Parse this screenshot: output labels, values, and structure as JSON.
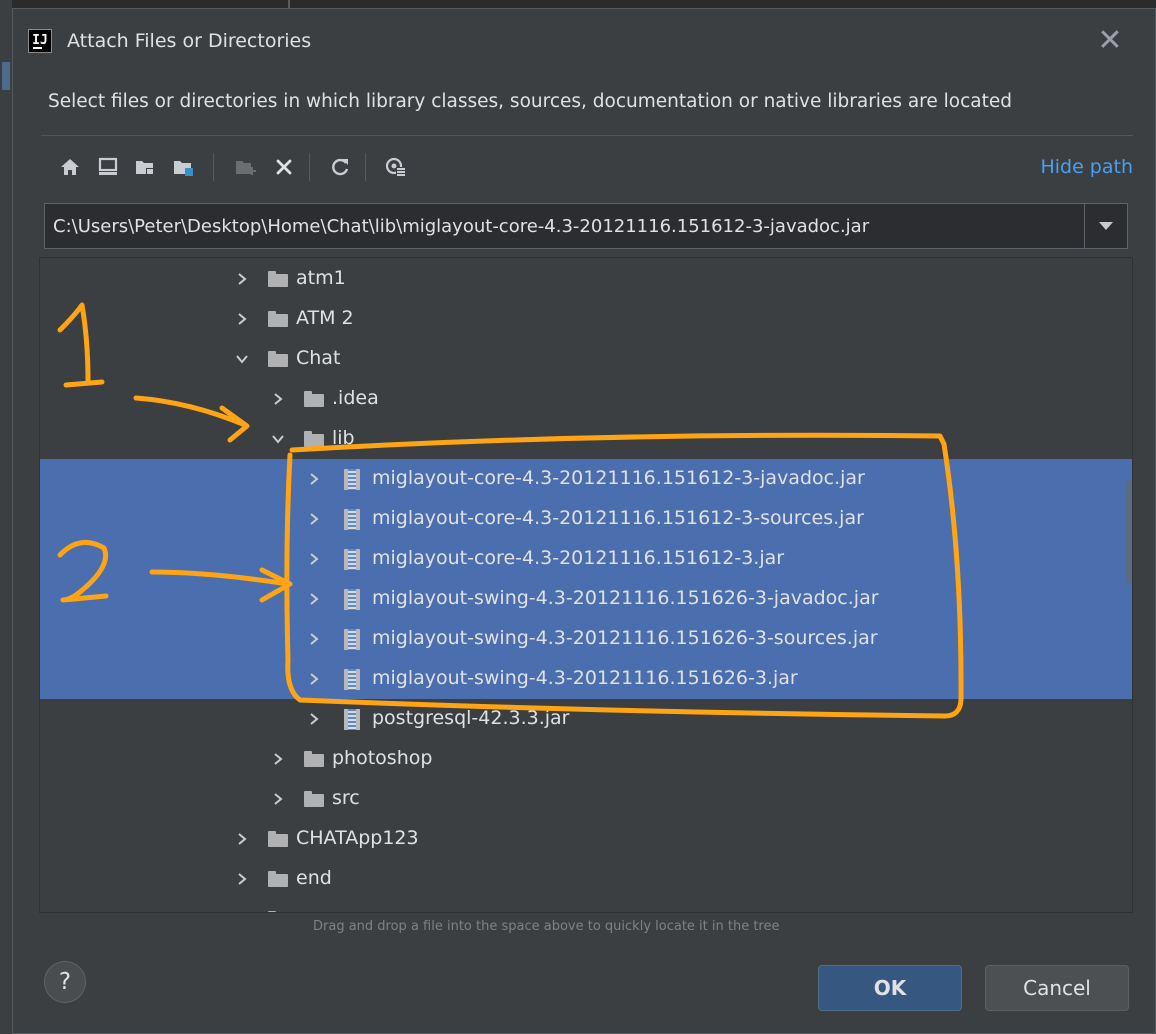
{
  "dialog": {
    "title": "Attach Files or Directories",
    "app_icon_text": "IJ",
    "description": "Select files or directories in which library classes, sources, documentation or native libraries are located"
  },
  "toolbar": {
    "buttons": [
      {
        "name": "home-icon"
      },
      {
        "name": "desktop-icon"
      },
      {
        "name": "project-folder-icon"
      },
      {
        "name": "module-folder-icon"
      },
      {
        "name": "new-folder-icon",
        "disabled": true
      },
      {
        "name": "delete-icon"
      },
      {
        "name": "refresh-icon"
      },
      {
        "name": "show-hidden-icon"
      }
    ],
    "hide_path_label": "Hide path"
  },
  "path": {
    "value": "C:\\Users\\Peter\\Desktop\\Home\\Chat\\lib\\miglayout-core-4.3-20121116.151612-3-javadoc.jar"
  },
  "tree": {
    "rows": [
      {
        "label": "atm1",
        "type": "folder",
        "depth": 0,
        "expanded": false,
        "selected": false
      },
      {
        "label": "ATM 2",
        "type": "folder",
        "depth": 0,
        "expanded": false,
        "selected": false
      },
      {
        "label": "Chat",
        "type": "folder",
        "depth": 0,
        "expanded": true,
        "selected": false
      },
      {
        "label": ".idea",
        "type": "folder",
        "depth": 1,
        "expanded": false,
        "selected": false
      },
      {
        "label": "lib",
        "type": "folder",
        "depth": 1,
        "expanded": true,
        "selected": false
      },
      {
        "label": "miglayout-core-4.3-20121116.151612-3-javadoc.jar",
        "type": "jar",
        "depth": 2,
        "expanded": false,
        "selected": true
      },
      {
        "label": "miglayout-core-4.3-20121116.151612-3-sources.jar",
        "type": "jar",
        "depth": 2,
        "expanded": false,
        "selected": true
      },
      {
        "label": "miglayout-core-4.3-20121116.151612-3.jar",
        "type": "jar",
        "depth": 2,
        "expanded": false,
        "selected": true
      },
      {
        "label": "miglayout-swing-4.3-20121116.151626-3-javadoc.jar",
        "type": "jar",
        "depth": 2,
        "expanded": false,
        "selected": true
      },
      {
        "label": "miglayout-swing-4.3-20121116.151626-3-sources.jar",
        "type": "jar",
        "depth": 2,
        "expanded": false,
        "selected": true
      },
      {
        "label": "miglayout-swing-4.3-20121116.151626-3.jar",
        "type": "jar",
        "depth": 2,
        "expanded": false,
        "selected": true
      },
      {
        "label": "postgresql-42.3.3.jar",
        "type": "jar",
        "depth": 2,
        "expanded": false,
        "selected": false
      },
      {
        "label": "photoshop",
        "type": "folder",
        "depth": 1,
        "expanded": false,
        "selected": false
      },
      {
        "label": "src",
        "type": "folder",
        "depth": 1,
        "expanded": false,
        "selected": false
      },
      {
        "label": "CHATApp123",
        "type": "folder",
        "depth": 0,
        "expanded": false,
        "selected": false
      },
      {
        "label": "end",
        "type": "folder",
        "depth": 0,
        "expanded": false,
        "selected": false
      },
      {
        "label": "",
        "type": "folder",
        "depth": 0,
        "expanded": false,
        "selected": false
      }
    ]
  },
  "drag_hint": "Drag and drop a file into the space above to quickly locate it in the tree",
  "buttons": {
    "help_label": "?",
    "ok_label": "OK",
    "cancel_label": "Cancel"
  },
  "annotations": {
    "color": "#ffa414",
    "marks": [
      "1",
      "2"
    ]
  },
  "colors": {
    "selection": "#4b6eaf",
    "link": "#4a9ff0",
    "dialog_bg": "#3c3f41"
  }
}
